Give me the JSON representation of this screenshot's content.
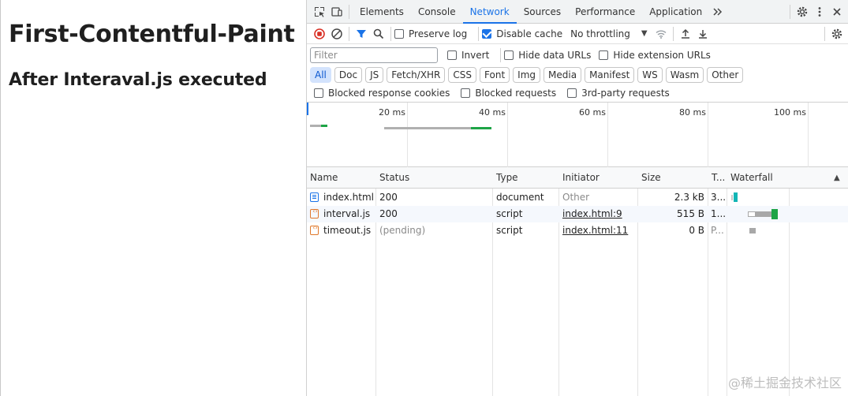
{
  "page": {
    "heading1": "First-Contentful-Paint",
    "heading2": "After Interaval.js executed"
  },
  "devtools": {
    "tabs": [
      {
        "label": "Elements",
        "active": false
      },
      {
        "label": "Console",
        "active": false
      },
      {
        "label": "Network",
        "active": true
      },
      {
        "label": "Sources",
        "active": false
      },
      {
        "label": "Performance",
        "active": false
      },
      {
        "label": "Application",
        "active": false
      }
    ],
    "more_tabs_icon": "chevron-double-right-icon",
    "toolbar": {
      "preserve_log": {
        "label": "Preserve log",
        "checked": false
      },
      "disable_cache": {
        "label": "Disable cache",
        "checked": true
      },
      "throttling": "No throttling"
    },
    "filter": {
      "placeholder": "Filter",
      "value": "",
      "invert": {
        "label": "Invert",
        "checked": false
      },
      "hide_data_urls": {
        "label": "Hide data URLs",
        "checked": false
      },
      "hide_extension_urls": {
        "label": "Hide extension URLs",
        "checked": false
      }
    },
    "type_filters": [
      {
        "label": "All",
        "active": true
      },
      {
        "label": "Doc",
        "active": false
      },
      {
        "label": "JS",
        "active": false
      },
      {
        "label": "Fetch/XHR",
        "active": false
      },
      {
        "label": "CSS",
        "active": false
      },
      {
        "label": "Font",
        "active": false
      },
      {
        "label": "Img",
        "active": false
      },
      {
        "label": "Media",
        "active": false
      },
      {
        "label": "Manifest",
        "active": false
      },
      {
        "label": "WS",
        "active": false
      },
      {
        "label": "Wasm",
        "active": false
      },
      {
        "label": "Other",
        "active": false
      }
    ],
    "blocking": {
      "blocked_response_cookies": {
        "label": "Blocked response cookies",
        "checked": false
      },
      "blocked_requests": {
        "label": "Blocked requests",
        "checked": false
      },
      "third_party_requests": {
        "label": "3rd-party requests",
        "checked": false
      }
    },
    "overview": {
      "ticks": [
        "20 ms",
        "40 ms",
        "60 ms",
        "80 ms",
        "100 ms"
      ]
    },
    "table": {
      "columns": [
        "Name",
        "Status",
        "Type",
        "Initiator",
        "Size",
        "T...",
        "Waterfall"
      ],
      "rows": [
        {
          "name": "index.html",
          "icon": "document-icon",
          "status": "200",
          "type": "document",
          "initiator": "Other",
          "size": "2.3 kB",
          "time": "3..."
        },
        {
          "name": "interval.js",
          "icon": "script-icon",
          "status": "200",
          "type": "script",
          "initiator": "index.html:9",
          "size": "515 B",
          "time": "1..."
        },
        {
          "name": "timeout.js",
          "icon": "script-icon",
          "status": "(pending)",
          "type": "script",
          "initiator": "index.html:11",
          "size": "0 B",
          "time": "P..."
        }
      ]
    },
    "colors": {
      "accent": "#1a73e8",
      "waiting": "#a8a8a8",
      "download": "#1ea446",
      "receive": "#13b5b5"
    }
  },
  "watermark": "@稀土掘金技术社区"
}
